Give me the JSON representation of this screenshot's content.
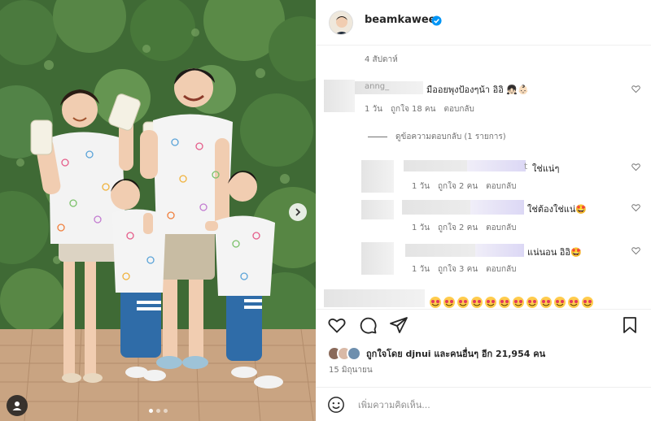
{
  "post": {
    "author": "beamkawee",
    "verified_icon": "verified-badge-icon",
    "time_ago": "4 สัปดาห์",
    "date": "15 มิถุนายน",
    "likes_text": "ถูกใจโดย djnui และคนอื่นๆ อีก 21,954 คน",
    "add_comment_placeholder": "เพิ่มความคิดเห็น..."
  },
  "comments": [
    {
      "username_partial": "anng_",
      "text": "มืออยพุงป้องๆน้า อิอิ 👧🏻👶🏻",
      "time": "1 วัน",
      "likes": "ถูกใจ 18 คน",
      "reply": "ตอบกลับ"
    }
  ],
  "view_replies": "ดูข้อความตอบกลับ (1 รายการ)",
  "replies": [
    {
      "username_partial": "t",
      "text": "ใช่แน่ๆ",
      "time": "1 วัน",
      "likes": "ถูกใจ 2 คน",
      "reply": "ตอบกลับ"
    },
    {
      "text": "ใช่ต้องใช่แน่🤩",
      "time": "1 วัน",
      "likes": "ถูกใจ 2 คน",
      "reply": "ตอบกลับ"
    },
    {
      "text": "แน่นอน อิอิ🤩",
      "time": "1 วัน",
      "likes": "ถูกใจ 3 คน",
      "reply": "ตอบกลับ"
    }
  ],
  "icons": {
    "like": "heart-icon",
    "comment": "comment-icon",
    "share": "send-icon",
    "save": "bookmark-icon",
    "emoji": "smiley-icon",
    "next": "chevron-right-icon",
    "tag": "user-tag-icon"
  },
  "colors": {
    "verified": "#0095f6",
    "muted": "#737373",
    "text": "#262626",
    "divider": "#efefef"
  }
}
